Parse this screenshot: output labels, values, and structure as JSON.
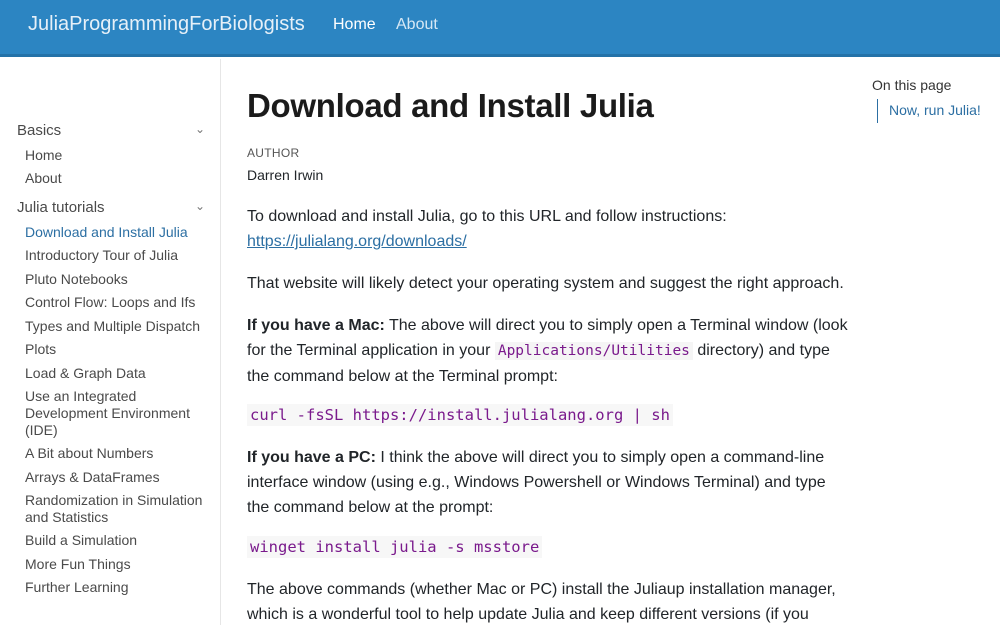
{
  "navbar": {
    "brand": "JuliaProgrammingForBiologists",
    "links": [
      "Home",
      "About"
    ]
  },
  "sidebar": {
    "sections": [
      {
        "title": "Basics",
        "chevron": "chevron-down-icon",
        "items": [
          "Home",
          "About"
        ]
      },
      {
        "title": "Julia tutorials",
        "chevron": "chevron-down-icon",
        "items": [
          "Download and Install Julia",
          "Introductory Tour of Julia",
          "Pluto Notebooks",
          "Control Flow: Loops and Ifs",
          "Types and Multiple Dispatch",
          "Plots",
          "Load & Graph Data",
          "Use an Integrated Development Environment (IDE)",
          "A Bit about Numbers",
          "Arrays & DataFrames",
          "Randomization in Simulation and Statistics",
          "Build a Simulation",
          "More Fun Things",
          "Further Learning"
        ]
      }
    ],
    "active_item": "Download and Install Julia"
  },
  "main": {
    "title": "Download and Install Julia",
    "author_label": "AUTHOR",
    "author": "Darren Irwin",
    "p1_text": "To download and install Julia, go to this URL and follow instructions:",
    "p1_link": "https://julialang.org/downloads/",
    "p2": "That website will likely detect your operating system and suggest the right approach.",
    "p3_bold": "If you have a Mac:",
    "p3_a": " The above will direct you to simply open a Terminal window (look for the Terminal application in your ",
    "p3_code": "Applications/Utilities",
    "p3_b": " directory) and type the command below at the Terminal prompt:",
    "code_mac": "curl -fsSL https://install.julialang.org | sh",
    "p4_bold": "If you have a PC:",
    "p4_text": " I think the above will direct you to simply open a command-line interface window (using e.g., Windows Powershell or Windows Terminal) and type the command below at the prompt:",
    "code_pc": "winget install julia -s msstore",
    "p5": "The above commands (whether Mac or PC) install the Juliaup installation manager, which is a wonderful tool to help update Julia and keep different versions (if you"
  },
  "toc": {
    "title": "On this page",
    "items": [
      "Now, run Julia!"
    ]
  },
  "colors": {
    "navbar": "#2c85c2",
    "link": "#2c6fa3",
    "code": "#7a1a8c"
  }
}
